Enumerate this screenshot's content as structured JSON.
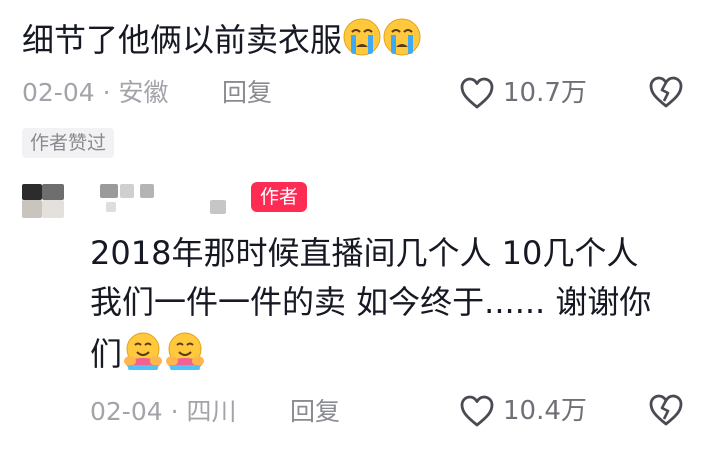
{
  "comment1": {
    "text": "细节了他俩以前卖衣服",
    "emojis": [
      "crying-face-icon",
      "crying-face-icon"
    ],
    "date": "02-04",
    "separator": "·",
    "location": "安徽",
    "reply_label": "回复",
    "like_count": "10.7万",
    "author_liked_tag": "作者赞过"
  },
  "comment2": {
    "author_tag": "作者",
    "text_line1": "2018年那时候直播间几个人 10几个人",
    "text_line2": "我们一件一件的卖 如今终于...... 谢谢你",
    "text_line3": "们",
    "emojis": [
      "hugging-face-icon",
      "hugging-face-icon"
    ],
    "date": "02-04",
    "separator": "·",
    "location": "四川",
    "reply_label": "回复",
    "like_count": "10.4万"
  },
  "colors": {
    "text": "#161823",
    "meta": "#a3a4aa",
    "author_tag_bg": "#fe2c55",
    "liked_tag_bg": "#f2f2f4"
  }
}
